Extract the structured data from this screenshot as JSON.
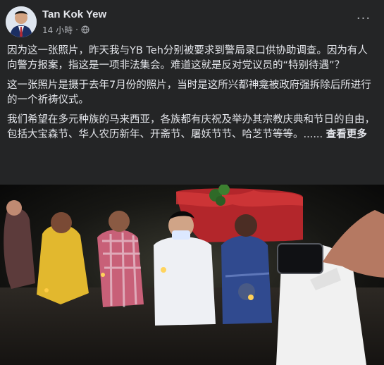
{
  "post": {
    "author": "Tan Kok Yew",
    "time": "14 小時",
    "separator": "·",
    "more": "···",
    "paragraphs": [
      "因为这一张照片，昨天我与YB Teh分别被要求到警局录口供协助调查。因为有人向警方报案，指这是一项非法集会。难道这就是反对党议员的“特别待遇”？",
      "这一张照片是摄于去年7月份的照片，当时是这所兴都神龛被政府强拆除后所进行的一个祈祷仪式。",
      "我们希望在多元种族的马来西亚，各族都有庆祝及举办其宗教庆典和节日的自由，包括大宝森节、华人农历新年、开斋节、屠妖节节、哈芝节等等。......"
    ],
    "see_more": "查看更多"
  },
  "icons": {
    "globe": "globe-icon",
    "more": "more-icon"
  },
  "colors": {
    "background": "#242526",
    "primary_text": "#e4e6eb",
    "secondary_text": "#b0b3b8"
  }
}
